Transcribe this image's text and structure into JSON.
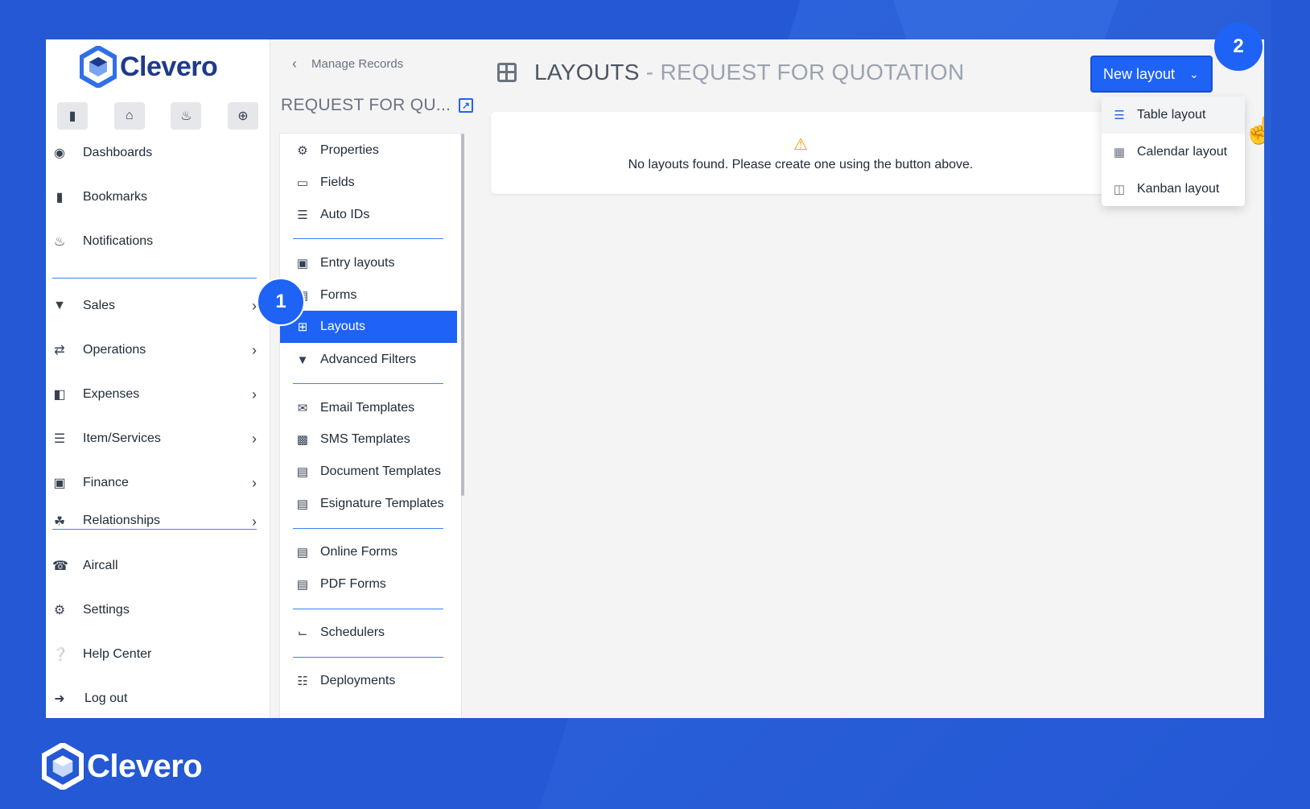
{
  "brand": {
    "name": "Clevero"
  },
  "left_nav": {
    "quick_actions": [
      "bookmark-icon",
      "home-icon",
      "bell-icon",
      "plus-circle-icon"
    ],
    "items": [
      {
        "label": "Dashboards",
        "icon": "dashboard-icon"
      },
      {
        "label": "Bookmarks",
        "icon": "bookmark-icon"
      },
      {
        "label": "Notifications",
        "icon": "bell-icon"
      },
      {
        "label": "Sales",
        "icon": "sales-icon"
      },
      {
        "label": "Operations",
        "icon": "operations-icon"
      },
      {
        "label": "Expenses",
        "icon": "expenses-icon"
      },
      {
        "label": "Item/Services",
        "icon": "list-icon"
      },
      {
        "label": "Finance",
        "icon": "finance-icon"
      },
      {
        "label": "Relationships",
        "icon": "handshake-icon"
      },
      {
        "label": "Aircall",
        "icon": "phone-icon"
      },
      {
        "label": "Settings",
        "icon": "gear-icon"
      },
      {
        "label": "Help Center",
        "icon": "help-icon"
      },
      {
        "label": "Log out",
        "icon": "logout-icon"
      }
    ]
  },
  "mid_panel": {
    "back_label": "Manage Records",
    "title": "REQUEST FOR QU...",
    "items": [
      {
        "label": "Properties",
        "icon": "gear-icon"
      },
      {
        "label": "Fields",
        "icon": "field-icon"
      },
      {
        "label": "Auto IDs",
        "icon": "barcode-icon"
      },
      {
        "label": "Entry layouts",
        "icon": "window-icon"
      },
      {
        "label": "Forms",
        "icon": "form-icon"
      },
      {
        "label": "Layouts",
        "icon": "grid-icon"
      },
      {
        "label": "Advanced Filters",
        "icon": "filter-icon"
      },
      {
        "label": "Email Templates",
        "icon": "envelope-icon"
      },
      {
        "label": "SMS Templates",
        "icon": "chat-icon"
      },
      {
        "label": "Document Templates",
        "icon": "word-doc-icon"
      },
      {
        "label": "Esignature Templates",
        "icon": "pdf-icon"
      },
      {
        "label": "Online Forms",
        "icon": "code-file-icon"
      },
      {
        "label": "PDF Forms",
        "icon": "pdf-plus-icon"
      },
      {
        "label": "Schedulers",
        "icon": "scheduler-icon"
      },
      {
        "label": "Deployments",
        "icon": "sitemap-icon"
      }
    ]
  },
  "main": {
    "title": "LAYOUTS",
    "subtitle": "- REQUEST FOR QUOTATION",
    "empty_message": "No layouts found. Please create one using the button above.",
    "new_button": "New layout",
    "dropdown": [
      {
        "label": "Table layout",
        "icon": "table-icon"
      },
      {
        "label": "Calendar layout",
        "icon": "calendar-icon"
      },
      {
        "label": "Kanban layout",
        "icon": "kanban-icon"
      }
    ]
  },
  "badges": [
    "1",
    "2"
  ],
  "colors": {
    "accent": "#1e63f5",
    "background": "#2458d4",
    "warning": "#f59e0b"
  }
}
